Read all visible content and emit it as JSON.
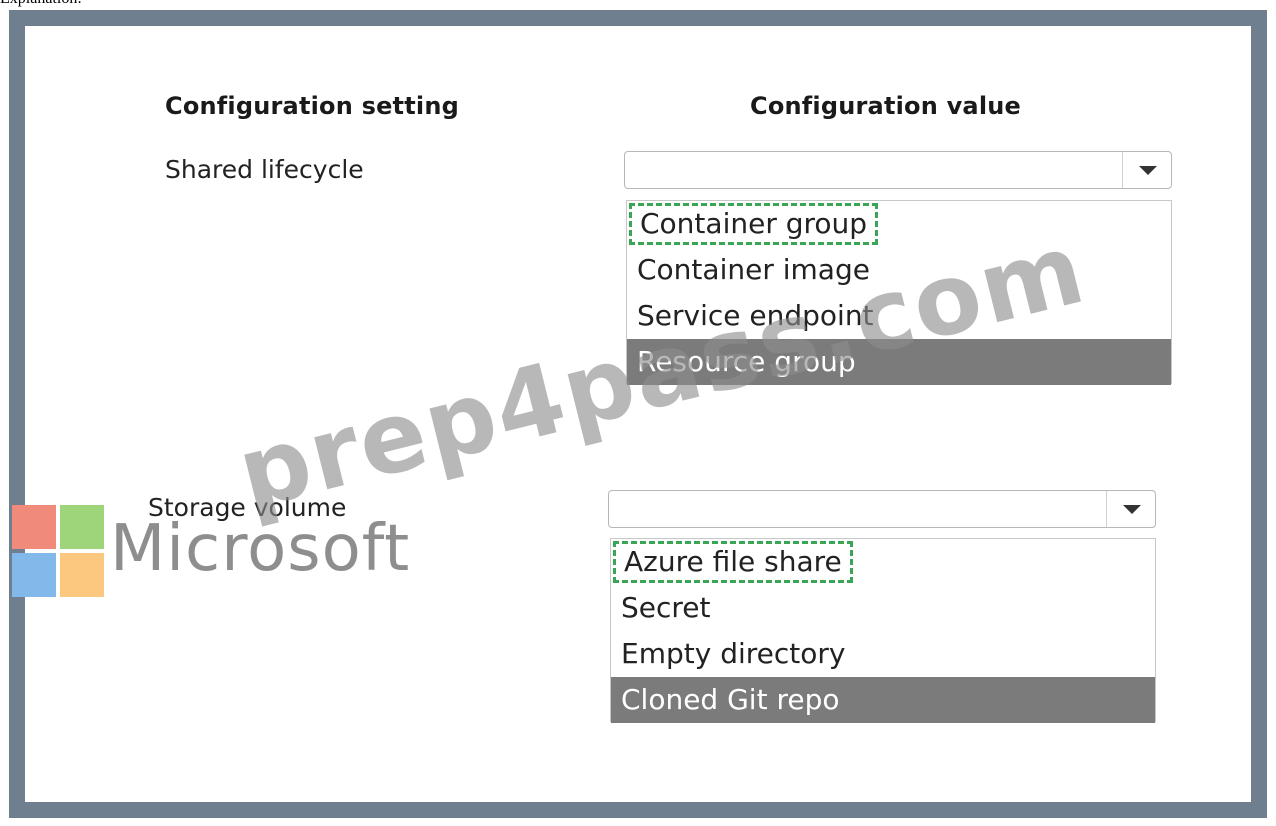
{
  "caption": "Explanation:",
  "headings": {
    "setting": "Configuration setting",
    "value": "Configuration value"
  },
  "rows": [
    {
      "label": "Shared lifecycle",
      "dropdown_value": "",
      "options": [
        {
          "label": "Container group",
          "marked_correct": true,
          "selected": false
        },
        {
          "label": "Container image",
          "marked_correct": false,
          "selected": false
        },
        {
          "label": "Service endpoint",
          "marked_correct": false,
          "selected": false
        },
        {
          "label": "Resource group",
          "marked_correct": false,
          "selected": true
        }
      ]
    },
    {
      "label": "Storage volume",
      "dropdown_value": "",
      "options": [
        {
          "label": "Azure file share",
          "marked_correct": true,
          "selected": false
        },
        {
          "label": "Secret",
          "marked_correct": false,
          "selected": false
        },
        {
          "label": "Empty directory",
          "marked_correct": false,
          "selected": false
        },
        {
          "label": "Cloned Git repo",
          "marked_correct": false,
          "selected": true
        }
      ]
    }
  ],
  "watermark": {
    "text": "prep4pass.com",
    "logo_text": "Microsoft"
  },
  "colors": {
    "frame_border": "#6f7f8f",
    "selected_option_bg": "#7b7b7b",
    "correct_answer_dash": "#3aa655"
  }
}
